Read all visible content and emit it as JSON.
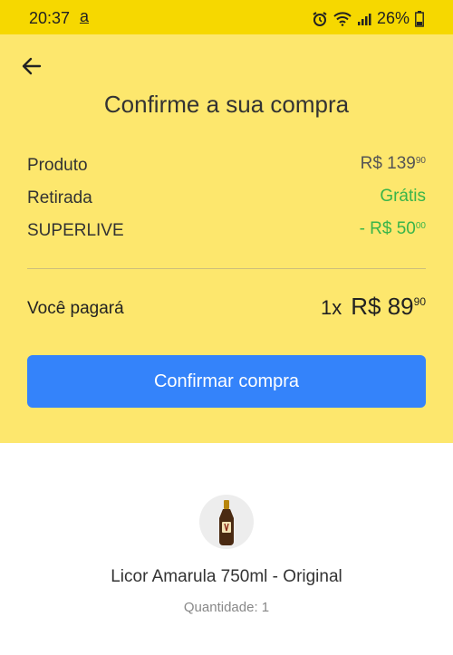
{
  "status_bar": {
    "time": "20:37",
    "app_indicator": "a",
    "battery": "26%",
    "icons": [
      "alarm-icon",
      "wifi-icon",
      "signal-icon",
      "battery-icon"
    ]
  },
  "header": {
    "back_icon": "arrow-left-icon",
    "title": "Confirme a sua compra"
  },
  "summary": {
    "product": {
      "label": "Produto",
      "value": "R$ 139",
      "cents": "90"
    },
    "pickup": {
      "label": "Retirada",
      "value": "Grátis"
    },
    "coupon": {
      "label": "SUPERLIVE",
      "value": "- R$ 50",
      "cents": "00"
    }
  },
  "total": {
    "label": "Você pagará",
    "quantity": "1x",
    "value": "R$ 89",
    "cents": "90"
  },
  "confirm_button": {
    "label": "Confirmar compra"
  },
  "product": {
    "name": "Licor Amarula 750ml - Original",
    "quantity_text": "Quantidade: 1"
  },
  "colors": {
    "status_bar": "#f6d800",
    "panel": "#fde76d",
    "button": "#3483fa",
    "green": "#39b54a"
  }
}
